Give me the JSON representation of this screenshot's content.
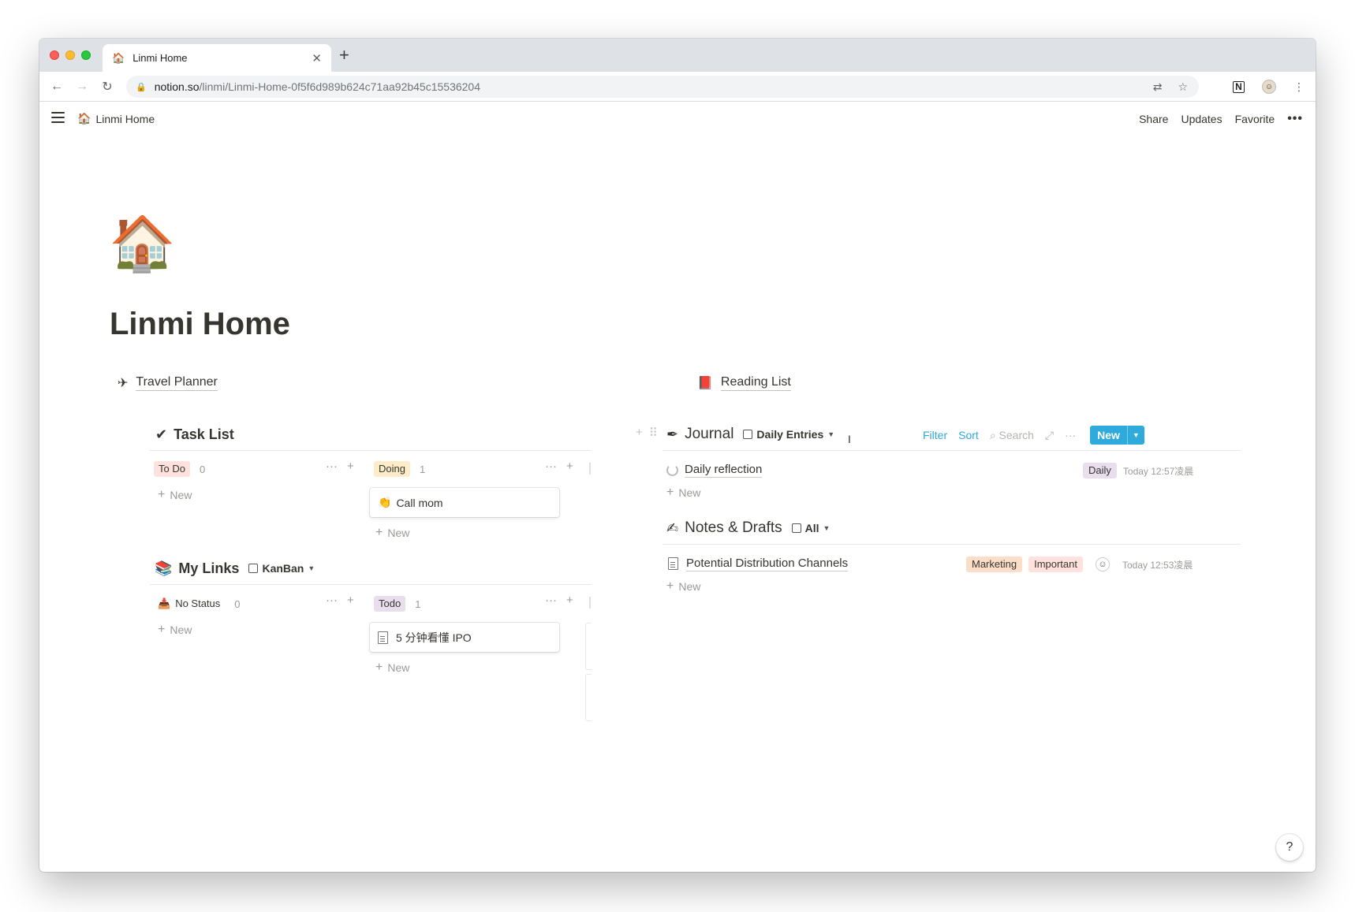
{
  "browser": {
    "tab_title": "Linmi Home",
    "tab_icon": "🏠",
    "url_host": "notion.so",
    "url_path": "/linmi/Linmi-Home-0f5f6d989b624c71aa92b45c15536204"
  },
  "topbar": {
    "breadcrumb_icon": "🏠",
    "breadcrumb": "Linmi Home",
    "share": "Share",
    "updates": "Updates",
    "favorite": "Favorite",
    "more": "•••"
  },
  "page": {
    "icon": "🏠",
    "title": "Linmi Home",
    "links": [
      {
        "icon": "✈",
        "label": "Travel Planner"
      },
      {
        "icon": "📕",
        "label": "Reading List"
      }
    ]
  },
  "task_list": {
    "icon": "✔",
    "title": "Task List",
    "columns": [
      {
        "label": "To Do",
        "count": "0",
        "cards": [],
        "new": "New"
      },
      {
        "label": "Doing",
        "count": "1",
        "cards": [
          {
            "icon": "👏",
            "title": "Call mom"
          }
        ],
        "new": "New"
      }
    ]
  },
  "my_links": {
    "icon": "📚",
    "title": "My Links",
    "view": "KanBan",
    "columns": [
      {
        "label": "No Status",
        "count": "0",
        "cards": [],
        "new": "New"
      },
      {
        "label": "Todo",
        "count": "1",
        "cards": [
          {
            "title": "5 分钟看懂 IPO"
          }
        ],
        "new": "New"
      }
    ]
  },
  "journal": {
    "icon": "✒",
    "title": "Journal",
    "view": "Daily Entries",
    "toolbar": {
      "filter": "Filter",
      "sort": "Sort",
      "search": "Search",
      "new": "New"
    },
    "rows": [
      {
        "title": "Daily reflection",
        "tag": "Daily",
        "time": "Today 12:57凌晨"
      }
    ],
    "new": "New"
  },
  "notes": {
    "icon": "✍",
    "title": "Notes & Drafts",
    "view": "All",
    "rows": [
      {
        "title": "Potential Distribution Channels",
        "tags": [
          "Marketing",
          "Important"
        ],
        "time": "Today 12:53凌晨"
      }
    ],
    "new": "New"
  },
  "help": "?"
}
